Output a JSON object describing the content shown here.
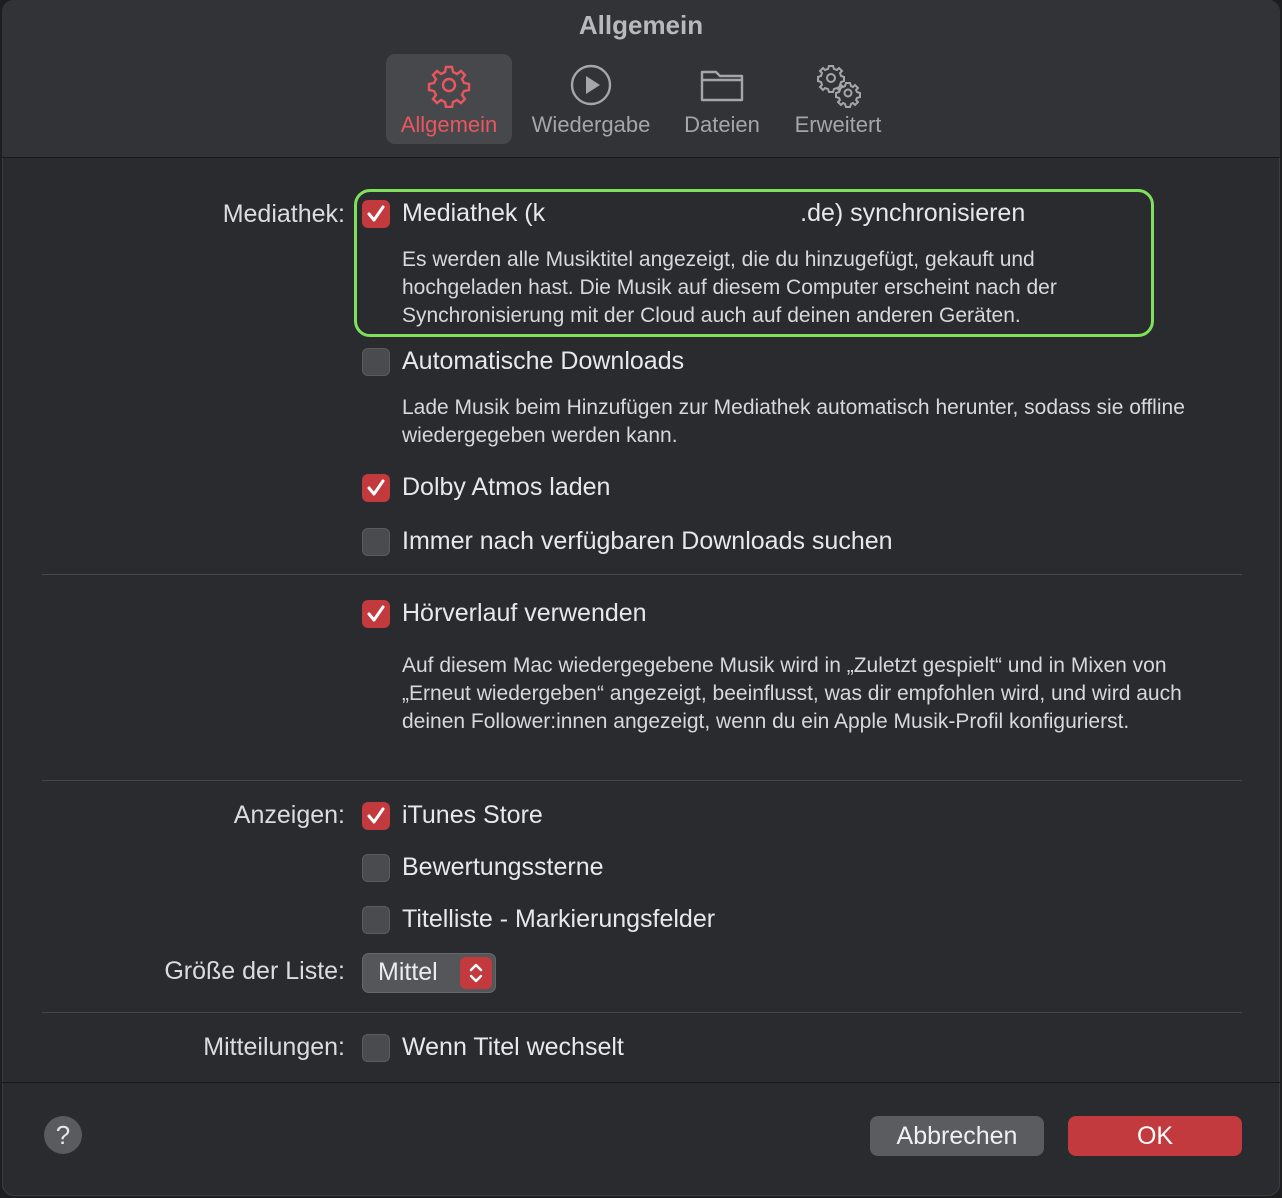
{
  "window": {
    "title": "Allgemein",
    "tabs": [
      {
        "label": "Allgemein",
        "icon": "gear-icon"
      },
      {
        "label": "Wiedergabe",
        "icon": "play-circle-icon"
      },
      {
        "label": "Dateien",
        "icon": "folder-icon"
      },
      {
        "label": "Erweitert",
        "icon": "gears-icon"
      }
    ]
  },
  "library": {
    "label": "Mediathek:",
    "sync": {
      "checked": true,
      "label_prefix": "Mediathek (k",
      "label_suffix": ".de) synchronisieren",
      "description": "Es werden alle Musiktitel angezeigt, die du hinzugefügt, gekauft und hochgeladen hast. Die Musik auf diesem Computer erscheint nach der Synchronisierung mit der Cloud auch auf deinen anderen Geräten."
    },
    "auto_downloads": {
      "checked": false,
      "label": "Automatische Downloads",
      "description": "Lade Musik beim Hinzufügen zur Mediathek automatisch herunter, sodass sie offline wiedergegeben werden kann."
    },
    "dolby": {
      "checked": true,
      "label": "Dolby Atmos laden"
    },
    "check_downloads": {
      "checked": false,
      "label": "Immer nach verfügbaren Downloads suchen"
    }
  },
  "history": {
    "checked": true,
    "label": "Hörverlauf verwenden",
    "description": "Auf diesem Mac wiedergegebene Musik wird in „Zuletzt gespielt“ und in Mixen von „Erneut wiedergeben“ angezeigt, beeinflusst, was dir empfohlen wird, und wird auch deinen Follower:innen angezeigt, wenn du ein Apple Musik-Profil konfigurierst."
  },
  "show": {
    "label": "Anzeigen:",
    "itunes": {
      "checked": true,
      "label": "iTunes Store"
    },
    "stars": {
      "checked": false,
      "label": "Bewertungssterne"
    },
    "checkboxes": {
      "checked": false,
      "label": "Titelliste - Markierungsfelder"
    }
  },
  "list_size": {
    "label": "Größe der Liste:",
    "value": "Mittel"
  },
  "notifications": {
    "label": "Mitteilungen:",
    "track_change": {
      "checked": false,
      "label": "Wenn Titel wechselt"
    }
  },
  "footer": {
    "help": "?",
    "cancel": "Abbrechen",
    "ok": "OK"
  },
  "colors": {
    "accent": "#c23a3e",
    "highlight": "#7ee05b",
    "tab_selected_text": "#e8575f"
  }
}
